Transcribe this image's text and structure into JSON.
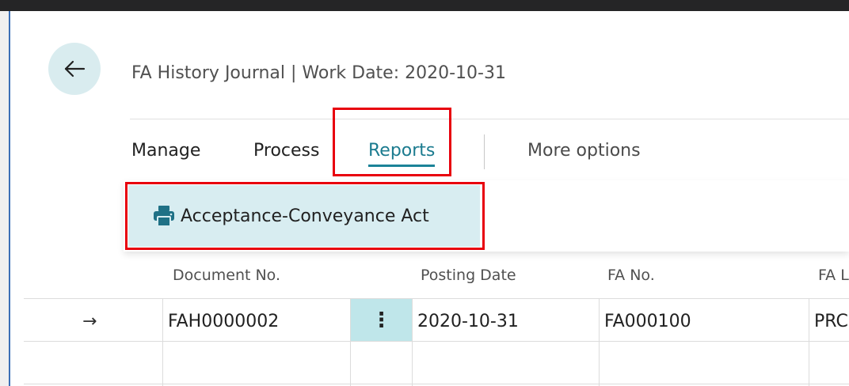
{
  "header": {
    "title": "FA History Journal | Work Date: 2020-10-31"
  },
  "tabs": {
    "manage": "Manage",
    "process": "Process",
    "reports": "Reports",
    "more": "More options"
  },
  "reports_menu": {
    "items": [
      {
        "label": "Acceptance-Conveyance Act",
        "icon": "printer-icon"
      }
    ]
  },
  "table": {
    "columns": [
      "Document No.",
      "Posting Date",
      "FA No.",
      "FA L"
    ],
    "rows": [
      {
        "marker": "→",
        "document_no": "FAH0000002",
        "actions": "⋮",
        "posting_date": "2020-10-31",
        "fa_no": "FA000100",
        "fa_location": "PRC"
      }
    ]
  },
  "colors": {
    "accent": "#1b8398",
    "highlight_box": "#e8000d",
    "selected_action_bg": "#d8edf1",
    "back_button_bg": "#d9ecef"
  }
}
